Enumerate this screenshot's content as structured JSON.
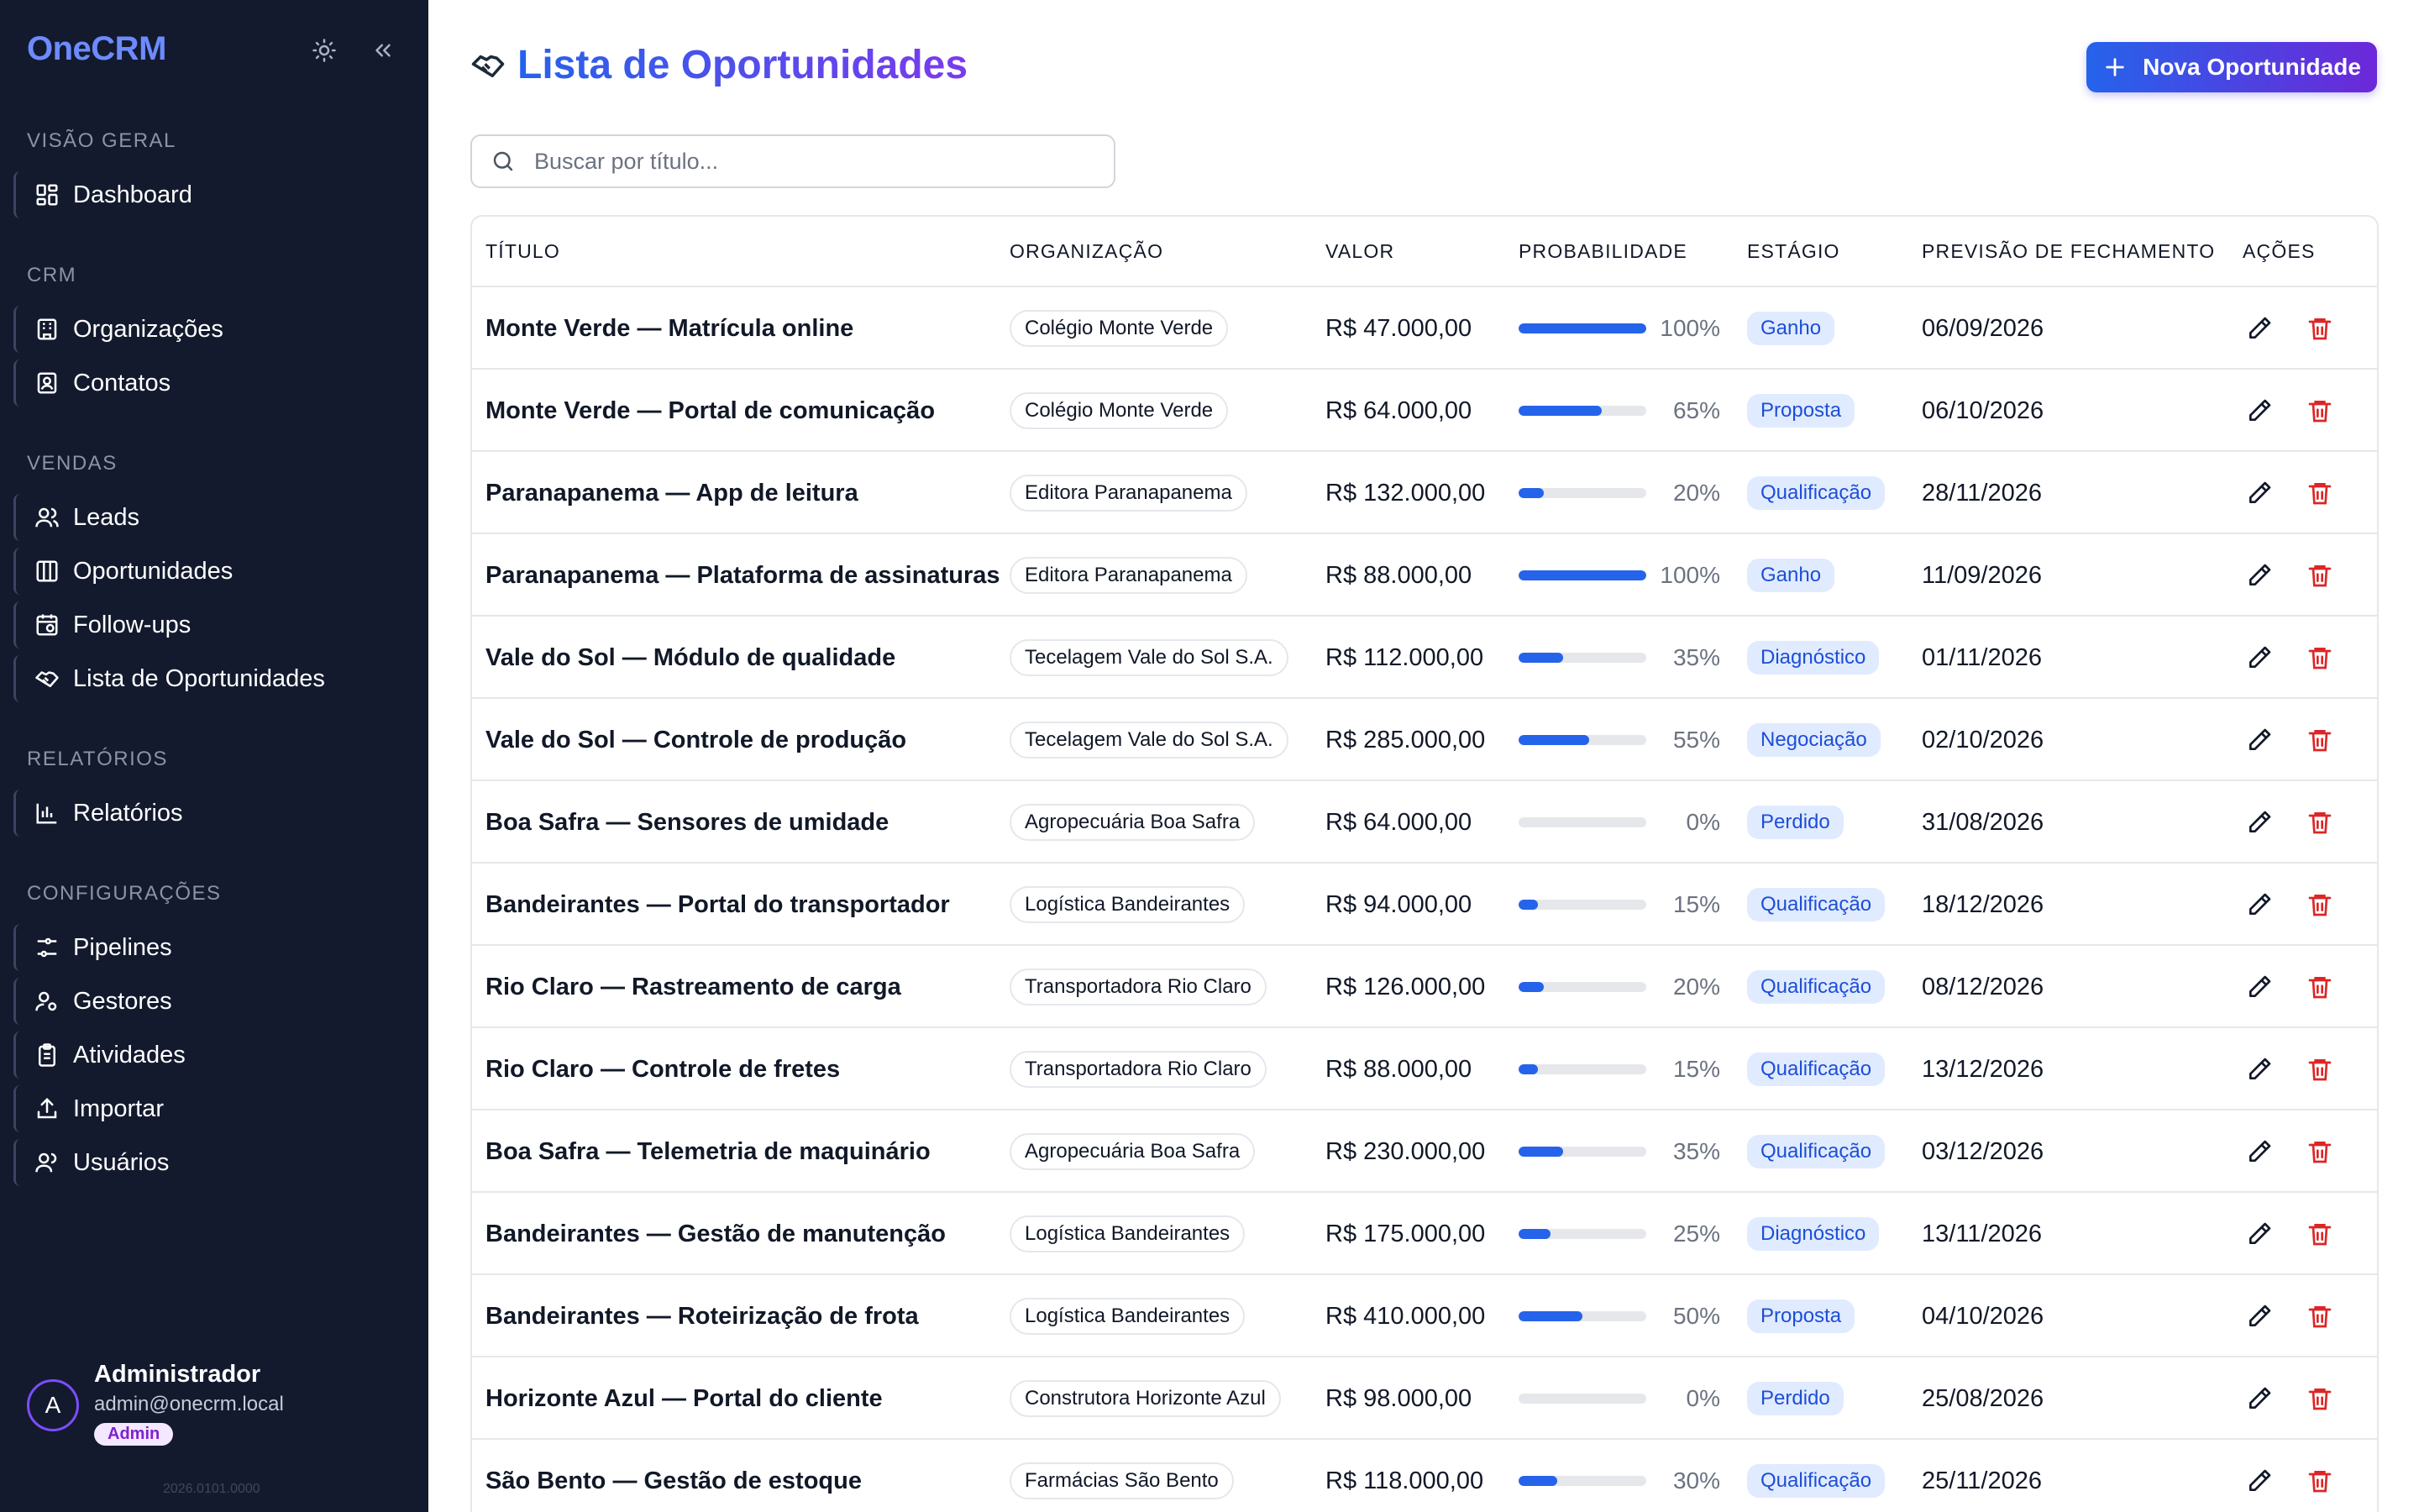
{
  "app": {
    "name": "OneCRM",
    "version": "2026.0101.0000"
  },
  "sidebar": {
    "sections": [
      {
        "title": "VISÃO GERAL",
        "items": [
          {
            "label": "Dashboard",
            "icon": "dashboard-icon"
          }
        ]
      },
      {
        "title": "CRM",
        "items": [
          {
            "label": "Organizações",
            "icon": "building-icon"
          },
          {
            "label": "Contatos",
            "icon": "contact-card-icon"
          }
        ]
      },
      {
        "title": "VENDAS",
        "items": [
          {
            "label": "Leads",
            "icon": "users-icon"
          },
          {
            "label": "Oportunidades",
            "icon": "columns-icon"
          },
          {
            "label": "Follow-ups",
            "icon": "calendar-clock-icon"
          },
          {
            "label": "Lista de Oportunidades",
            "icon": "handshake-icon"
          }
        ]
      },
      {
        "title": "RELATÓRIOS",
        "items": [
          {
            "label": "Relatórios",
            "icon": "bar-chart-icon"
          }
        ]
      },
      {
        "title": "CONFIGURAÇÕES",
        "items": [
          {
            "label": "Pipelines",
            "icon": "pipeline-icon"
          },
          {
            "label": "Gestores",
            "icon": "user-cog-icon"
          },
          {
            "label": "Atividades",
            "icon": "clipboard-icon"
          },
          {
            "label": "Importar",
            "icon": "upload-icon"
          },
          {
            "label": "Usuários",
            "icon": "users-icon"
          }
        ]
      }
    ]
  },
  "user": {
    "initial": "A",
    "name": "Administrador",
    "email": "admin@onecrm.local",
    "role": "Admin"
  },
  "header": {
    "title": "Lista de Oportunidades",
    "new_button": "Nova Oportunidade"
  },
  "search": {
    "placeholder": "Buscar por título..."
  },
  "table": {
    "columns": [
      "TÍTULO",
      "ORGANIZAÇÃO",
      "VALOR",
      "PROBABILIDADE",
      "ESTÁGIO",
      "PREVISÃO DE FECHAMENTO",
      "AÇÕES"
    ],
    "rows": [
      {
        "title": "Monte Verde — Matrícula online",
        "org": "Colégio Monte Verde",
        "value": "R$ 47.000,00",
        "prob": 100,
        "prob_text": "100%",
        "stage": "Ganho",
        "date": "06/09/2026"
      },
      {
        "title": "Monte Verde — Portal de comunicação",
        "org": "Colégio Monte Verde",
        "value": "R$ 64.000,00",
        "prob": 65,
        "prob_text": "65%",
        "stage": "Proposta",
        "date": "06/10/2026"
      },
      {
        "title": "Paranapanema — App de leitura",
        "org": "Editora Paranapanema",
        "value": "R$ 132.000,00",
        "prob": 20,
        "prob_text": "20%",
        "stage": "Qualificação",
        "date": "28/11/2026"
      },
      {
        "title": "Paranapanema — Plataforma de assinaturas",
        "org": "Editora Paranapanema",
        "value": "R$ 88.000,00",
        "prob": 100,
        "prob_text": "100%",
        "stage": "Ganho",
        "date": "11/09/2026"
      },
      {
        "title": "Vale do Sol — Módulo de qualidade",
        "org": "Tecelagem Vale do Sol S.A.",
        "value": "R$ 112.000,00",
        "prob": 35,
        "prob_text": "35%",
        "stage": "Diagnóstico",
        "date": "01/11/2026"
      },
      {
        "title": "Vale do Sol — Controle de produção",
        "org": "Tecelagem Vale do Sol S.A.",
        "value": "R$ 285.000,00",
        "prob": 55,
        "prob_text": "55%",
        "stage": "Negociação",
        "date": "02/10/2026"
      },
      {
        "title": "Boa Safra — Sensores de umidade",
        "org": "Agropecuária Boa Safra",
        "value": "R$ 64.000,00",
        "prob": 0,
        "prob_text": "0%",
        "stage": "Perdido",
        "date": "31/08/2026"
      },
      {
        "title": "Bandeirantes — Portal do transportador",
        "org": "Logística Bandeirantes",
        "value": "R$ 94.000,00",
        "prob": 15,
        "prob_text": "15%",
        "stage": "Qualificação",
        "date": "18/12/2026"
      },
      {
        "title": "Rio Claro — Rastreamento de carga",
        "org": "Transportadora Rio Claro",
        "value": "R$ 126.000,00",
        "prob": 20,
        "prob_text": "20%",
        "stage": "Qualificação",
        "date": "08/12/2026"
      },
      {
        "title": "Rio Claro — Controle de fretes",
        "org": "Transportadora Rio Claro",
        "value": "R$ 88.000,00",
        "prob": 15,
        "prob_text": "15%",
        "stage": "Qualificação",
        "date": "13/12/2026"
      },
      {
        "title": "Boa Safra — Telemetria de maquinário",
        "org": "Agropecuária Boa Safra",
        "value": "R$ 230.000,00",
        "prob": 35,
        "prob_text": "35%",
        "stage": "Qualificação",
        "date": "03/12/2026"
      },
      {
        "title": "Bandeirantes — Gestão de manutenção",
        "org": "Logística Bandeirantes",
        "value": "R$ 175.000,00",
        "prob": 25,
        "prob_text": "25%",
        "stage": "Diagnóstico",
        "date": "13/11/2026"
      },
      {
        "title": "Bandeirantes — Roteirização de frota",
        "org": "Logística Bandeirantes",
        "value": "R$ 410.000,00",
        "prob": 50,
        "prob_text": "50%",
        "stage": "Proposta",
        "date": "04/10/2026"
      },
      {
        "title": "Horizonte Azul — Portal do cliente",
        "org": "Construtora Horizonte Azul",
        "value": "R$ 98.000,00",
        "prob": 0,
        "prob_text": "0%",
        "stage": "Perdido",
        "date": "25/08/2026"
      },
      {
        "title": "São Bento — Gestão de estoque",
        "org": "Farmácias São Bento",
        "value": "R$ 118.000,00",
        "prob": 30,
        "prob_text": "30%",
        "stage": "Qualificação",
        "date": "25/11/2026"
      }
    ]
  },
  "colors": {
    "sidebar_bg": "#131a2e",
    "accent": "#2563eb",
    "accent2": "#6d28d9",
    "danger": "#dc2626",
    "stage_bg": "#e0ebff",
    "stage_fg": "#1d4ed8"
  }
}
